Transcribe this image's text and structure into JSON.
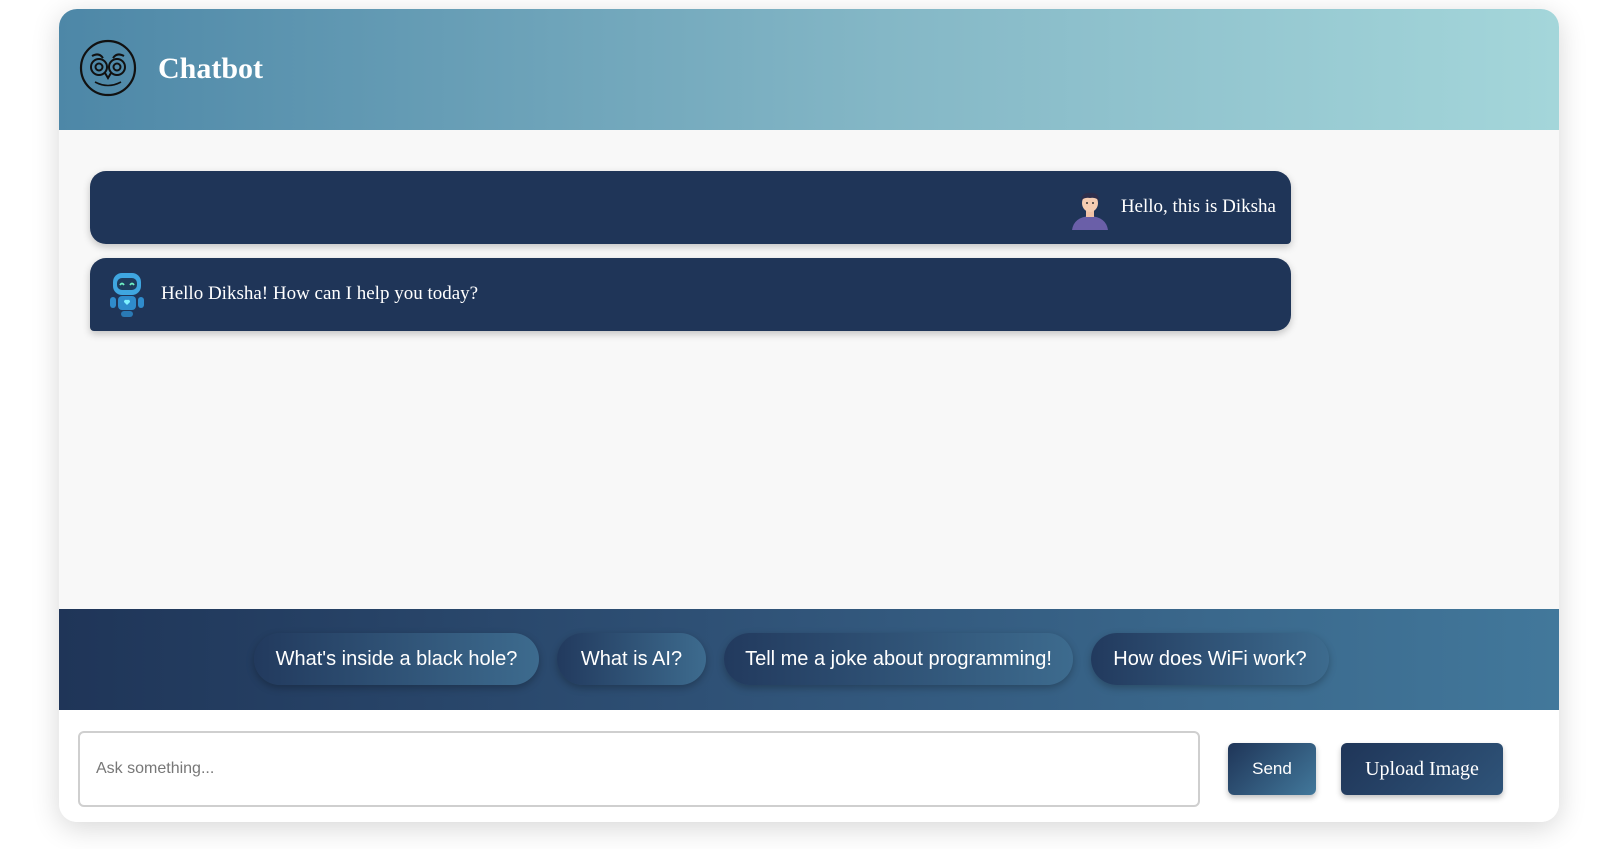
{
  "header": {
    "title": "Chatbot",
    "logo_icon": "owl-icon"
  },
  "messages": [
    {
      "sender": "user",
      "avatar_icon": "user-avatar-icon",
      "text": "Hello, this is Diksha"
    },
    {
      "sender": "bot",
      "avatar_icon": "robot-avatar-icon",
      "text": "Hello Diksha! How can I help you today?"
    }
  ],
  "suggestions": [
    "What's inside a black hole?",
    "What is AI?",
    "Tell me a joke about programming!",
    "How does WiFi work?"
  ],
  "input": {
    "value": "",
    "placeholder": "Ask something..."
  },
  "buttons": {
    "send_label": "Send",
    "upload_label": "Upload Image"
  },
  "colors": {
    "bubble": "#1f3558",
    "header_start": "#4d87a7",
    "header_end": "#a4d6da",
    "accent": "#42789b"
  }
}
